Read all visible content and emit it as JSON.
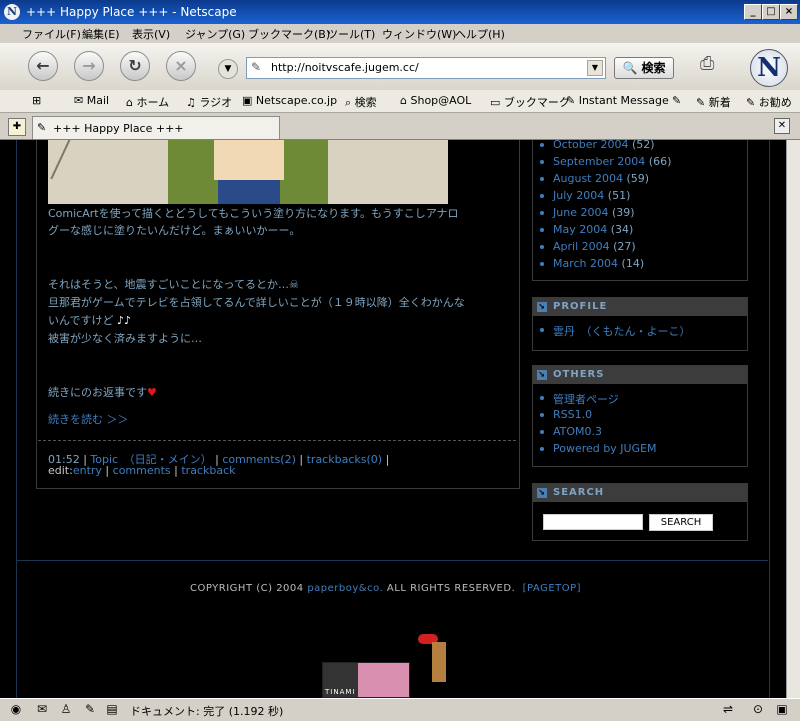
{
  "window": {
    "title": "+++ Happy Place +++ - Netscape",
    "app_icon": "N"
  },
  "window_controls": {
    "minimize": "_",
    "maximize": "□",
    "close": "×"
  },
  "menu": [
    "ファイル(F)",
    "編集(E)",
    "表示(V)",
    "ジャンプ(G)",
    "ブックマーク(B)",
    "ツール(T)",
    "ウィンドウ(W)",
    "ヘルプ(H)"
  ],
  "nav": {
    "back_icon": "←",
    "forward_icon": "→",
    "reload_icon": "↻",
    "stop_icon": "×",
    "url": "http://noitvscafe.jugem.cc/",
    "search_label": "🔍 検索",
    "logo": "N"
  },
  "personal_toolbar": [
    "Mail",
    "ホーム",
    "ラジオ",
    "Netscape.co.jp",
    "検索",
    "Shop@AOL",
    "ブックマーク",
    "Instant Message",
    "新着",
    "お勧め"
  ],
  "tab": {
    "title": "+++ Happy Place +++"
  },
  "entry": {
    "lines": [
      "ComicArtを使って描くとどうしてもこういう塗り方になります。もうすこしアナロ",
      "グーな感じに塗りたいんだけど。まぁいいかーー。",
      "それはそうと、地震すごいことになってるとか…",
      "旦那君がゲームでテレビを占領してるんで詳しいことが（１９時以降）全くわかんな",
      "いんですけど",
      "被害が少なく済みますように…",
      "続きにのお返事です"
    ],
    "read_more": "続きを読む ＞＞",
    "time": "01:52",
    "category": "Topic　（日記・メイン）",
    "comments": "comments(2)",
    "trackbacks": "trackbacks(0)",
    "edit_label": "edit:",
    "edit_entry": "entry",
    "edit_comments": "comments",
    "edit_trackback": "trackback",
    "divider": "|"
  },
  "archives": [
    {
      "label": "October 2004",
      "count": "(52)"
    },
    {
      "label": "September 2004",
      "count": "(66)"
    },
    {
      "label": "August 2004",
      "count": "(59)"
    },
    {
      "label": "July 2004",
      "count": "(51)"
    },
    {
      "label": "June 2004",
      "count": "(39)"
    },
    {
      "label": "May 2004",
      "count": "(34)"
    },
    {
      "label": "April 2004",
      "count": "(27)"
    },
    {
      "label": "March 2004",
      "count": "(14)"
    }
  ],
  "profile": {
    "title": "PROFILE",
    "name": "雲丹　（くもたん・よーこ）"
  },
  "others": {
    "title": "OTHERS",
    "items": [
      "管理者ページ",
      "RSS1.0",
      "ATOM0.3",
      "Powered by JUGEM"
    ]
  },
  "search": {
    "title": "SEARCH",
    "button": "SEARCH"
  },
  "footer": {
    "copy_pre": "COPYRIGHT (C) 2004",
    "copy_link": "paperboy&co.",
    "copy_post": "ALL RIGHTS RESERVED.",
    "pagetop": "[PAGETOP]"
  },
  "banner": {
    "text": "TINAMI"
  },
  "status": {
    "text": "ドキュメント: 完了 (1.192 秒)"
  }
}
